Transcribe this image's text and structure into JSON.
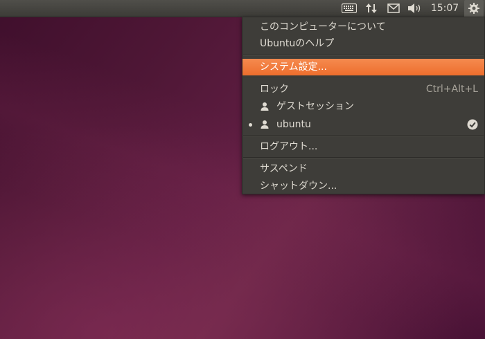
{
  "panel": {
    "clock": "15:07",
    "indicators": {
      "keyboard": "keyboard-icon",
      "network": "network-updown-icon",
      "mail": "envelope-icon",
      "sound": "speaker-volume-icon",
      "session": "gear-icon"
    }
  },
  "menu": {
    "about": "このコンピューターについて",
    "help": "Ubuntuのヘルプ",
    "system_settings": "システム設定...",
    "lock": "ロック",
    "lock_accel": "Ctrl+Alt+L",
    "guest_session": "ゲストセッション",
    "current_user": "ubuntu",
    "logout": "ログアウト...",
    "suspend": "サスペンド",
    "shutdown": "シャットダウン..."
  },
  "colors": {
    "highlight": "#f07746",
    "panel": "#3c3b37",
    "menu_bg": "#3e3d39",
    "wallpaper": "#5e1d41"
  }
}
